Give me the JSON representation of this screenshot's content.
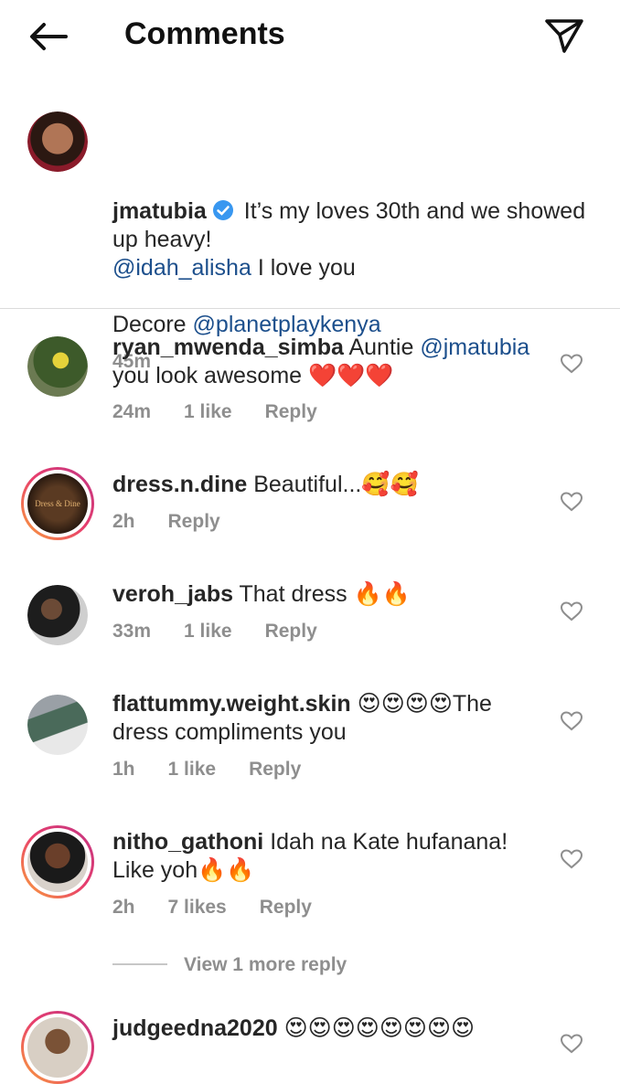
{
  "header": {
    "title": "Comments",
    "back_icon": "arrow-left-icon",
    "send_icon": "paper-plane-icon"
  },
  "caption": {
    "username": "jmatubia",
    "verified_icon": "verified-badge-icon",
    "line1": " It’s my loves 30th and we showed up heavy!",
    "mention1": "@idah_alisha",
    "line2": " I love you",
    "line3": "Decore ",
    "mention2": "@planetplaykenya",
    "time": "45m"
  },
  "comments": [
    {
      "username": "ryan_mwenda_simba",
      "text_prefix": " Auntie ",
      "mention": "@jmatubia",
      "text_suffix": " you look awesome ❤️❤️❤️",
      "time": "24m",
      "likes": "1 like",
      "reply": "Reply"
    },
    {
      "username": "dress.n.dine",
      "text": " Beautiful...🥰🥰",
      "time": "2h",
      "reply": "Reply",
      "avatar_text": "Dress & Dine"
    },
    {
      "username": "veroh_jabs",
      "text": " That dress 🔥🔥",
      "time": "33m",
      "likes": "1 like",
      "reply": "Reply"
    },
    {
      "username": "flattummy.weight.skin",
      "text": " 😍😍😍😍The dress compliments you",
      "time": "1h",
      "likes": "1 like",
      "reply": "Reply"
    },
    {
      "username": "nitho_gathoni",
      "text": " Idah na Kate hufanana! Like yoh🔥🔥",
      "time": "2h",
      "likes": "7 likes",
      "reply": "Reply"
    },
    {
      "username": "judgeedna2020",
      "text": " 😍😍😍😍😍😍😍😍"
    }
  ],
  "view_more": "View 1 more reply",
  "colors": {
    "mention": "#1c4f8c",
    "verified": "#3897f0",
    "meta": "#8e8e8e",
    "divider": "#dbdbdb"
  }
}
